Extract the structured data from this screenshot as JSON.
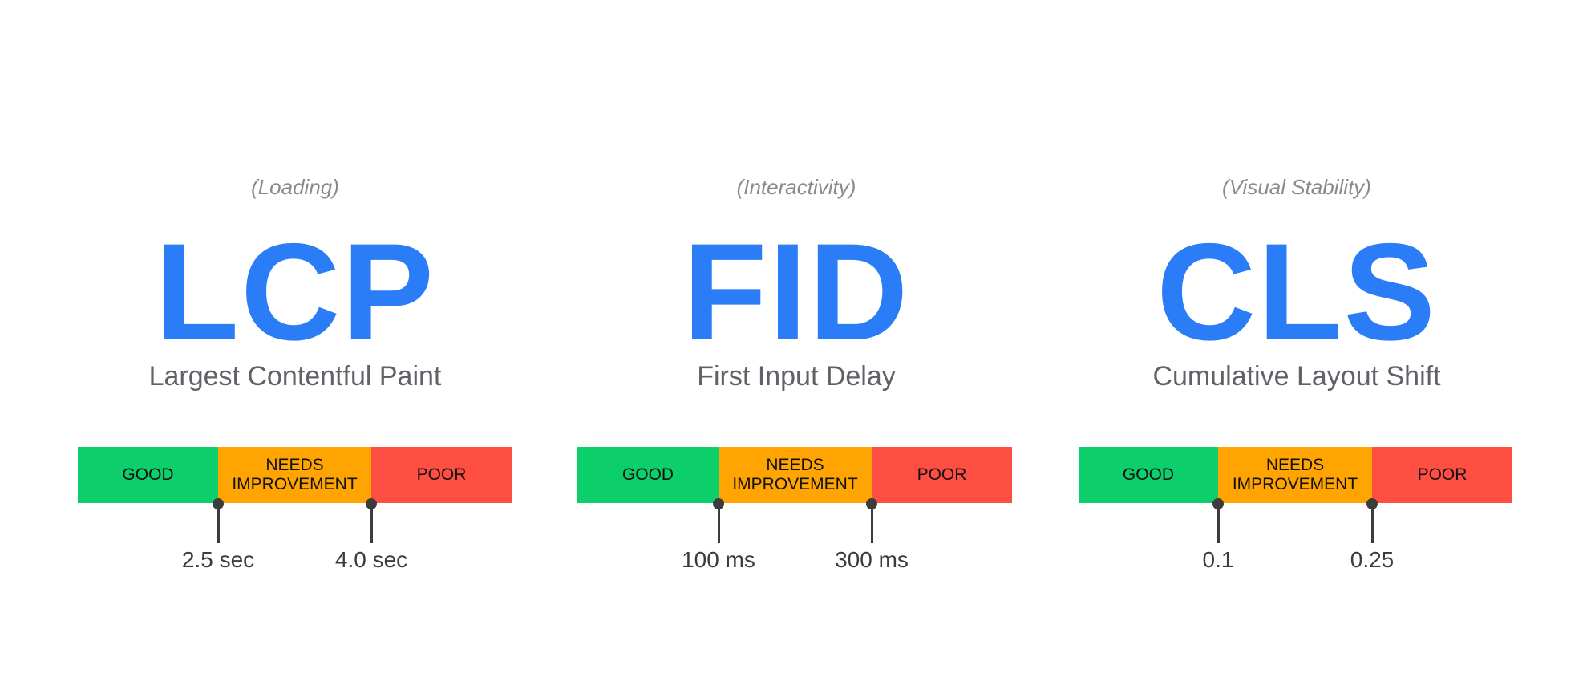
{
  "colors": {
    "accent": "#2a7df7",
    "good": "#0cce6b",
    "needs_improvement": "#ffa400",
    "poor": "#ff4e42"
  },
  "segments": {
    "good": "GOOD",
    "needs_1": "NEEDS",
    "needs_2": "IMPROVEMENT",
    "poor": "POOR"
  },
  "metrics": [
    {
      "category": "(Loading)",
      "abbr": "LCP",
      "name": "Largest Contentful Paint",
      "threshold_1": "2.5 sec",
      "threshold_2": "4.0 sec"
    },
    {
      "category": "(Interactivity)",
      "abbr": "FID",
      "name": "First Input Delay",
      "threshold_1": "100 ms",
      "threshold_2": "300 ms"
    },
    {
      "category": "(Visual Stability)",
      "abbr": "CLS",
      "name": "Cumulative Layout Shift",
      "threshold_1": "0.1",
      "threshold_2": "0.25"
    }
  ]
}
